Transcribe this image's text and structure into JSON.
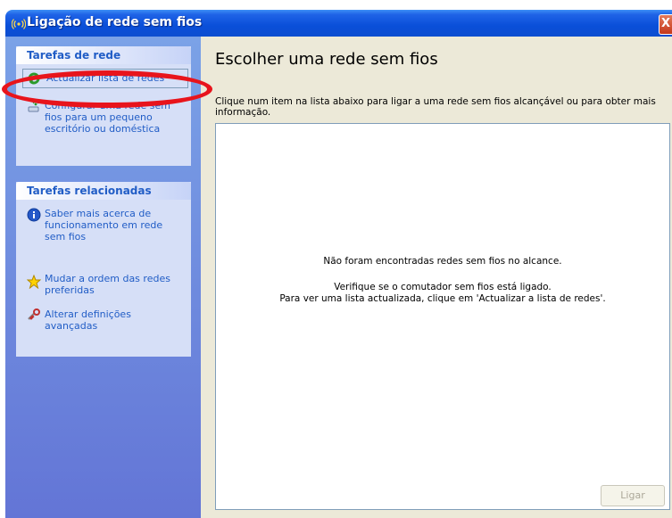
{
  "window": {
    "title": "Ligação de rede sem fios",
    "close_glyph": "X",
    "title_icon": "wireless-network-icon"
  },
  "sidebar": {
    "network_tasks": {
      "header": "Tarefas de rede",
      "items": [
        {
          "label": "Actualizar lista de redes",
          "icon": "refresh-icon",
          "selected": true
        },
        {
          "label": "Configurar uma rede sem fios para um pequeno escritório ou doméstica",
          "icon": "setup-wizard-icon"
        }
      ]
    },
    "related_tasks": {
      "header": "Tarefas relacionadas",
      "items": [
        {
          "label": "Saber mais acerca de funcionamento em rede sem fios",
          "icon": "info-icon"
        },
        {
          "label": "Mudar a ordem das redes preferidas",
          "icon": "star-icon"
        },
        {
          "label": "Alterar definições avançadas",
          "icon": "settings-icon"
        }
      ]
    }
  },
  "main": {
    "title": "Escolher uma rede sem fios",
    "instructions": "Clique num item na lista abaixo para ligar a uma rede sem fios alcançável ou para obter mais informação.",
    "list": {
      "no_networks": "Não foram encontradas redes sem fios no alcance.",
      "check_switch": "Verifique se o comutador sem fios está ligado.",
      "refresh_hint": "Para ver uma lista actualizada, clique em 'Actualizar a lista de redes'."
    },
    "connect_button": "Ligar"
  },
  "colors": {
    "titlebar": "#0a4fd9",
    "sidebar_link": "#215dc6",
    "annotation_ellipse": "#e8141c"
  }
}
